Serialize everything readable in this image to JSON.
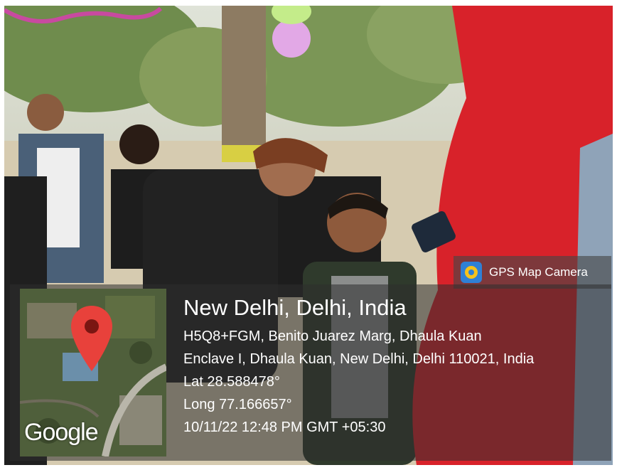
{
  "watermark": {
    "app_name": "GPS Map Camera",
    "map_logo": "Google",
    "map_pin_icon": "location-pin-icon",
    "place_title": "New Delhi, Delhi, India",
    "address_line_1": "H5Q8+FGM, Benito Juarez Marg, Dhaula Kuan",
    "address_line_2": "Enclave I, Dhaula Kuan, New Delhi, Delhi 110021, India",
    "latitude": "Lat 28.588478°",
    "longitude": "Long 77.166657°",
    "timestamp": "10/11/22 12:48 PM GMT +05:30"
  },
  "colors": {
    "pin": "#e8413b",
    "hood": "#d8222a",
    "overlay": "#2d2d2d"
  }
}
